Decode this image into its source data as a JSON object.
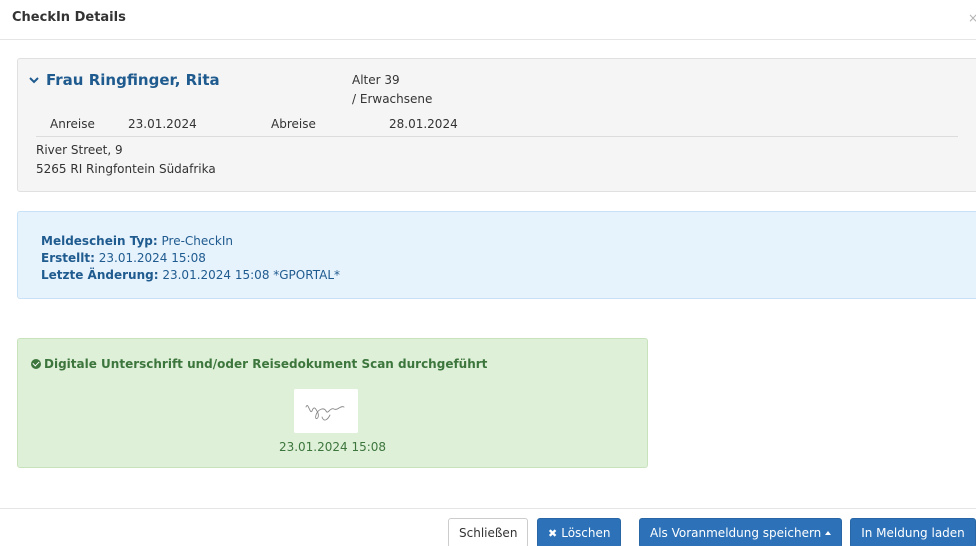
{
  "dialog": {
    "title": "CheckIn Details",
    "close_label": "×"
  },
  "guest": {
    "name": "Frau Ringfinger, Rita",
    "age_line1": "Alter 39",
    "age_line2": "/ Erwachsene",
    "arrival_label": "Anreise",
    "arrival_date": "23.01.2024",
    "departure_label": "Abreise",
    "departure_date": "28.01.2024",
    "address_line1": "River Street, 9",
    "address_line2": "5265 RI Ringfontein Südafrika"
  },
  "info": {
    "type_label": "Meldeschein Typ:",
    "type_value": "Pre-CheckIn",
    "created_label": "Erstellt:",
    "created_value": "23.01.2024 15:08",
    "changed_label": "Letzte Änderung:",
    "changed_value": "23.01.2024 15:08 *GPORTAL*"
  },
  "signature": {
    "heading": "Digitale Unterschrift und/oder Reisedokument Scan durchgeführt",
    "date": "23.01.2024 15:08"
  },
  "footer": {
    "close_button": "Schließen",
    "delete_icon": "✖",
    "delete_button": "Löschen",
    "save_pre_button": "Als Voranmeldung speichern",
    "load_button": "In Meldung laden"
  },
  "colors": {
    "primary": "#2d72b8",
    "name_blue": "#1f5b8f",
    "success_green": "#3c763d",
    "info_bg": "#e6f2fc",
    "success_bg": "#dff0d8"
  },
  "icons": [
    "chevron-down-icon",
    "check-circle-icon",
    "times-icon",
    "caret-up-icon",
    "close-icon"
  ]
}
